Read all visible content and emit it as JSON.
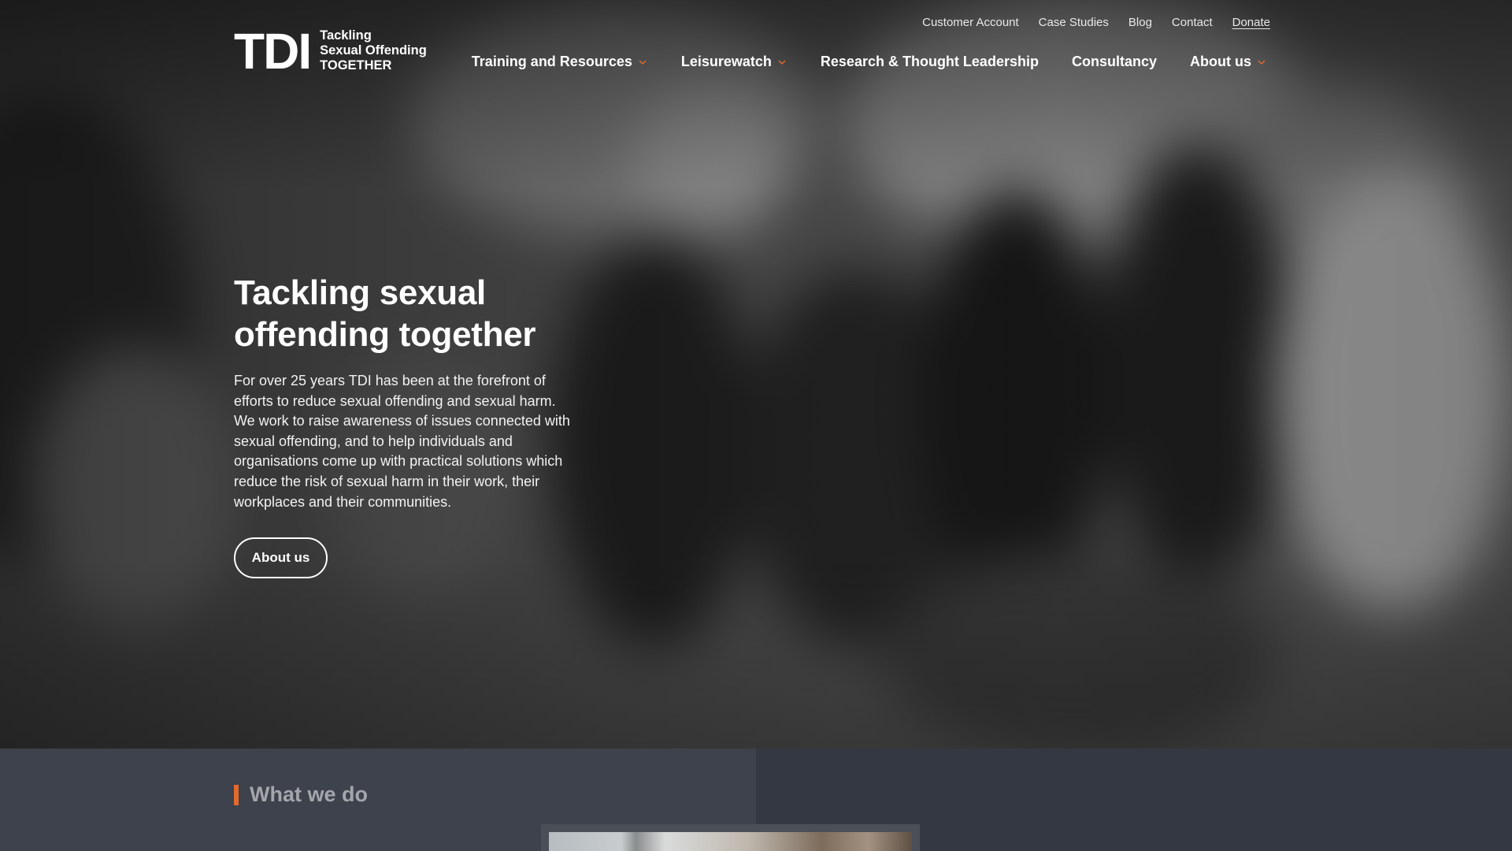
{
  "logo": {
    "mark": "TDI",
    "line1": "Tackling",
    "line2": "Sexual Offending",
    "line3": "TOGETHER"
  },
  "utility_nav": [
    {
      "label": "Customer Account"
    },
    {
      "label": "Case Studies"
    },
    {
      "label": "Blog"
    },
    {
      "label": "Contact"
    },
    {
      "label": "Donate"
    }
  ],
  "main_nav": [
    {
      "label": "Training and Resources",
      "icon": "chevron-down-icon"
    },
    {
      "label": "Leisurewatch",
      "icon": "chevron-down-icon"
    },
    {
      "label": "Research & Thought Leadership"
    },
    {
      "label": "Consultancy"
    },
    {
      "label": "About us",
      "icon": "chevron-down-icon"
    }
  ],
  "hero": {
    "title": "Tackling sexual offending together",
    "description": "For over 25 years TDI has been at the forefront of efforts to reduce sexual offending and sexual harm. We work to raise awareness of issues connected with sexual offending, and to help individuals and organisations come up with practical solutions which reduce the risk of sexual harm in their work, their workplaces and their communities.",
    "button_label": "About us"
  },
  "section": {
    "title": "What we do"
  },
  "colors": {
    "accent": "#e36a2c",
    "section_bg": "#333843"
  }
}
